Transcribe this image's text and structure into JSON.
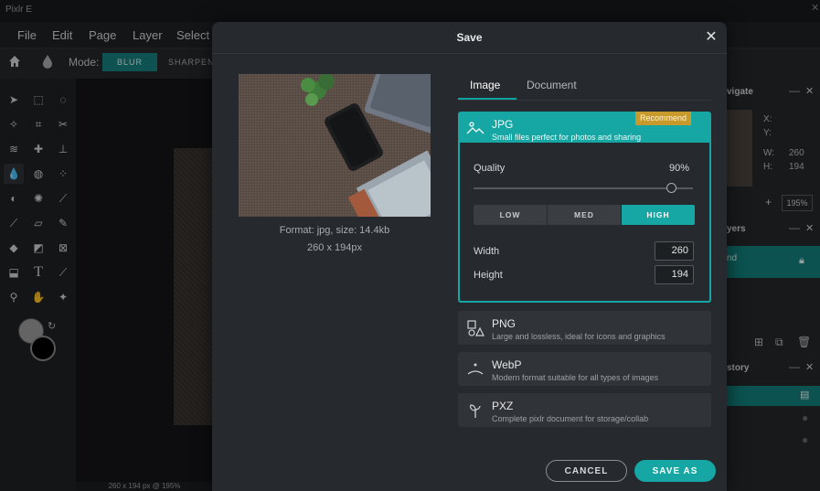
{
  "app": {
    "title": "Pixlr E"
  },
  "menu": [
    "File",
    "Edit",
    "Page",
    "Layer",
    "Select"
  ],
  "tool_options": {
    "mode_label": "Mode:",
    "blur_label": "BLUR",
    "sharpen_label": "SHARPEN"
  },
  "right_panels": {
    "navigate_title": "vigate",
    "layers_title": "yers",
    "history_title": "story",
    "x_label": "X:",
    "y_label": "Y:",
    "w_label": "W:",
    "w_value": "260",
    "h_label": "H:",
    "h_value": "194",
    "zoom_value": "195%",
    "layer_name": "nd"
  },
  "status": {
    "text": "260 x 194 px @ 195%"
  },
  "dialog": {
    "title": "Save",
    "close": "✕",
    "format_info": "Format: jpg, size: 14.4kb",
    "dimensions_info": "260 x 194px",
    "tabs": {
      "image": "Image",
      "document": "Document"
    },
    "jpg": {
      "name": "JPG",
      "desc": "Small files perfect for photos and sharing",
      "badge": "Recommend"
    },
    "quality": {
      "label": "Quality",
      "value": "90%",
      "percent": 90
    },
    "quality_presets": {
      "low": "LOW",
      "med": "MED",
      "high": "HIGH",
      "selected": "HIGH"
    },
    "width": {
      "label": "Width",
      "value": "260"
    },
    "height": {
      "label": "Height",
      "value": "194"
    },
    "png": {
      "name": "PNG",
      "desc": "Large and lossless, ideal for icons and graphics"
    },
    "webp": {
      "name": "WebP",
      "desc": "Modern format suitable for all types of images"
    },
    "pxz": {
      "name": "PXZ",
      "desc": "Complete pixlr document for storage/collab"
    },
    "cancel_label": "CANCEL",
    "save_label": "SAVE AS"
  },
  "colors": {
    "accent": "#16a6a3",
    "badge": "#c79a2b",
    "dialog_bg": "#26292d"
  }
}
